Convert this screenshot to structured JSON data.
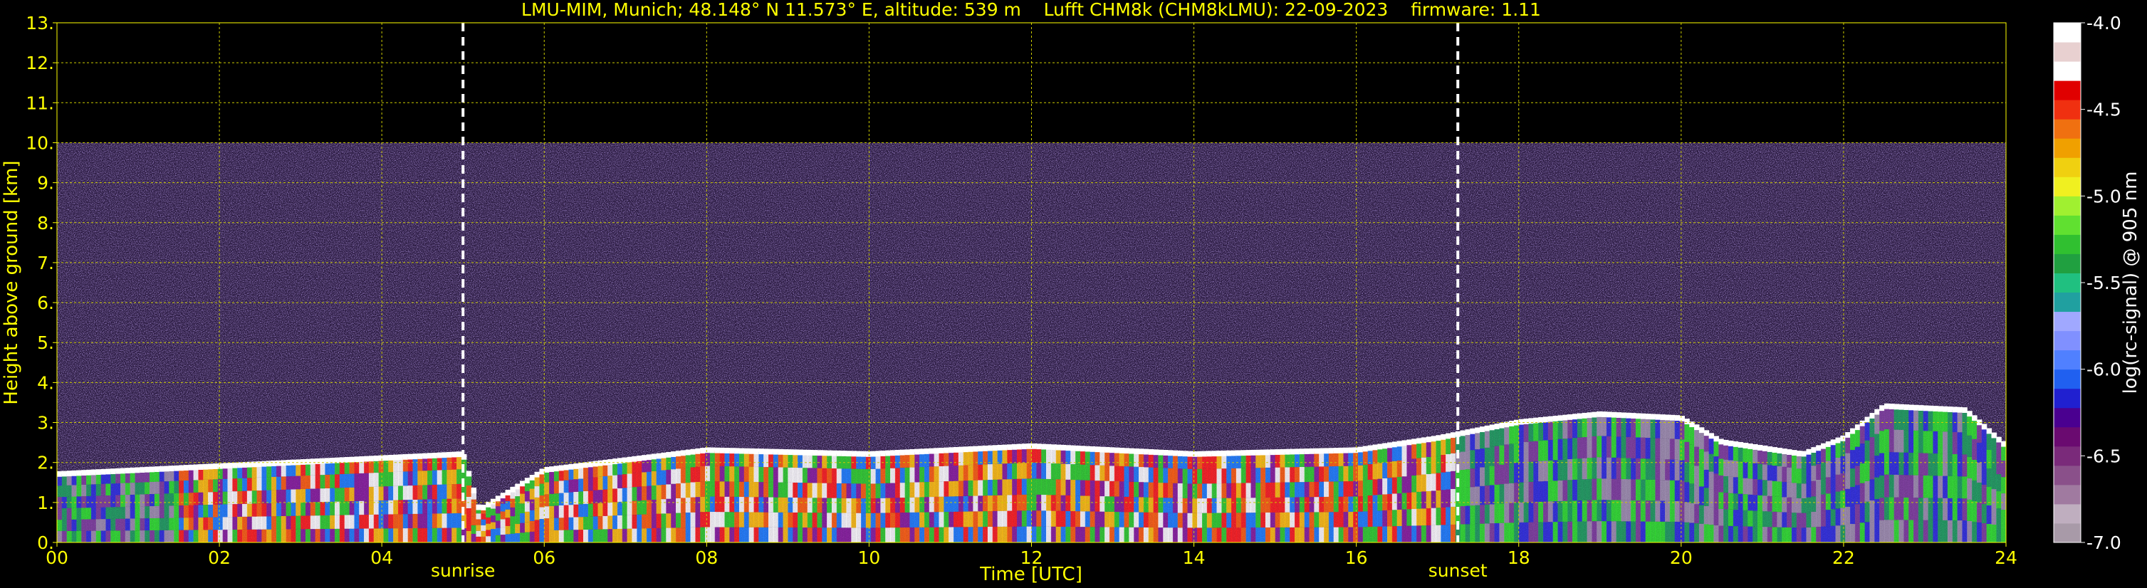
{
  "chart_data": {
    "type": "heatmap",
    "title": "LMU-MIM, Munich; 48.148° N 11.573° E, altitude: 539 m    Lufft CHM8k (CHM8kLMU): 22-09-2023    firmware: 1.11",
    "xlabel": "Time [UTC]",
    "ylabel": "Height above ground [km]",
    "xlim": [
      0,
      24
    ],
    "ylim": [
      0,
      13
    ],
    "x_ticks": [
      "00",
      "02",
      "04",
      "06",
      "08",
      "10",
      "12",
      "14",
      "16",
      "18",
      "20",
      "22",
      "24"
    ],
    "y_ticks": [
      "0.",
      "1.",
      "2.",
      "3.",
      "4.",
      "5.",
      "6.",
      "7.",
      "8.",
      "9.",
      "10.",
      "11.",
      "12.",
      "13."
    ],
    "grid": true,
    "colorbar": {
      "label": "log(rc-signal) @ 905 nm",
      "range": [
        -7.0,
        -4.0
      ],
      "ticks": [
        "-4.0",
        "-4.5",
        "-5.0",
        "-5.5",
        "-6.0",
        "-6.5",
        "-7.0"
      ],
      "colors": [
        "#a89aa8",
        "#bfaebf",
        "#a07aa0",
        "#8a508a",
        "#7a2a7a",
        "#6a0a70",
        "#4a0090",
        "#2020d0",
        "#2060f0",
        "#5080ff",
        "#8090ff",
        "#a0a8ff",
        "#20a0a0",
        "#20c080",
        "#20a040",
        "#30c030",
        "#60e030",
        "#a0f030",
        "#f0f020",
        "#f0d010",
        "#f0a000",
        "#f07010",
        "#f03010",
        "#e00000",
        "#ffffff",
        "#e8d0d0",
        "#ffffff"
      ]
    },
    "annotations": [
      {
        "text": "sunrise",
        "x": 5.0
      },
      {
        "text": "sunset",
        "x": 17.25
      }
    ],
    "signal_top_km": 10.0,
    "boundary_layer_top_km": [
      [
        0,
        1.7
      ],
      [
        2,
        1.9
      ],
      [
        4,
        2.1
      ],
      [
        5,
        2.2
      ],
      [
        5.2,
        0.8
      ],
      [
        6,
        1.8
      ],
      [
        8,
        2.3
      ],
      [
        10,
        2.2
      ],
      [
        12,
        2.4
      ],
      [
        14,
        2.2
      ],
      [
        16,
        2.3
      ],
      [
        17,
        2.6
      ],
      [
        18,
        3.0
      ],
      [
        19,
        3.2
      ],
      [
        20,
        3.1
      ],
      [
        20.5,
        2.5
      ],
      [
        21.5,
        2.2
      ],
      [
        22,
        2.6
      ],
      [
        22.5,
        3.4
      ],
      [
        23.5,
        3.3
      ],
      [
        24,
        2.4
      ]
    ]
  }
}
